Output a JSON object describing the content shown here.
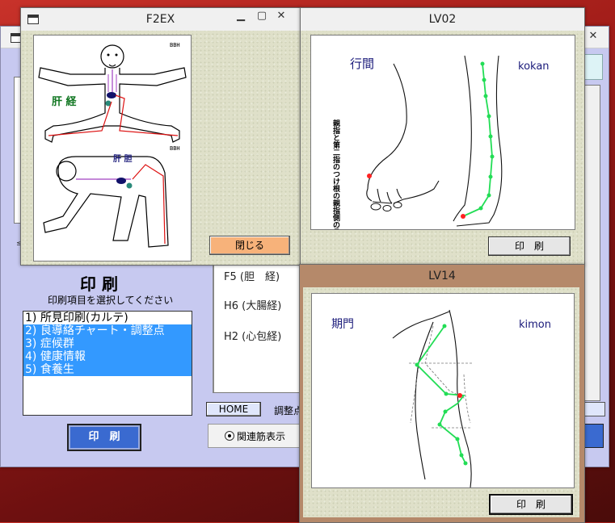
{
  "main_window": {
    "print_heading": "印 刷",
    "print_instruction": "印刷項目を選択してください",
    "print_items": [
      {
        "label": "1) 所見印刷(カルテ)",
        "selected": false
      },
      {
        "label": "2) 良導絡チャート・調整点",
        "selected": true
      },
      {
        "label": "3) 症候群",
        "selected": true
      },
      {
        "label": "4) 健康情報",
        "selected": true
      },
      {
        "label": "5) 食養生",
        "selected": true
      }
    ],
    "print_button": "印　刷",
    "meridian_list": [
      "F5 (胆　経)",
      "H6 (大腸経)",
      "H2 (心包経)"
    ],
    "home_tab": "HOME",
    "adjust_tab": "調整点",
    "related_radio_label": "関連筋表示",
    "left_char": "≤"
  },
  "f2ex": {
    "title": "F2EX",
    "label_upper": "肝 経",
    "label_lower": "肝 胆",
    "code_upper": "BBH",
    "code_lower": "BBH",
    "close_button": "閉じる"
  },
  "lv02": {
    "title": "LV02",
    "name_jp": "行間",
    "name_romaji": "kokan",
    "description": "親指と第二指のつけ根の親指側の骨側",
    "print_button": "印　刷"
  },
  "lv14": {
    "title": "LV14",
    "name_jp": "期門",
    "name_romaji": "kimon",
    "print_button": "印　刷"
  },
  "colors": {
    "main_bg": "#c7c9f0",
    "selection": "#3399ff",
    "green_line": "#22dd55",
    "point_red": "#ff2222",
    "meridian_red": "#dd1111",
    "lv14_frame": "#b5896a",
    "close_btn": "#f7b27a"
  }
}
